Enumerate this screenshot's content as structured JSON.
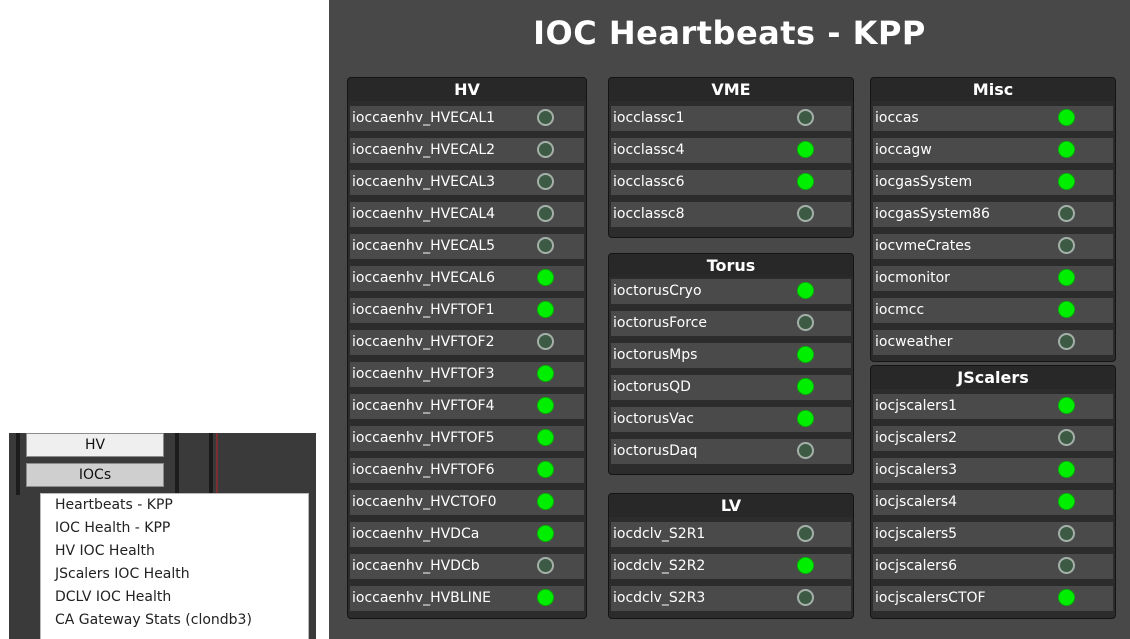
{
  "menu": {
    "hv_button": "HV",
    "iocs_button": "IOCs",
    "items": [
      "Heartbeats - KPP",
      "IOC Health - KPP",
      "HV IOC Health",
      "JScalers IOC Health",
      "DCLV IOC Health",
      "CA Gateway Stats (clondb3)"
    ]
  },
  "title": "IOC Heartbeats - KPP",
  "colors": {
    "led_on": "#00ee00",
    "led_off": "#3d5a44",
    "panel_bg": "#484848"
  },
  "groups": {
    "hv": {
      "title": "HV",
      "rows": [
        {
          "name": "ioccaenhv_HVECAL1",
          "status": "off"
        },
        {
          "name": "ioccaenhv_HVECAL2",
          "status": "off"
        },
        {
          "name": "ioccaenhv_HVECAL3",
          "status": "off"
        },
        {
          "name": "ioccaenhv_HVECAL4",
          "status": "off"
        },
        {
          "name": "ioccaenhv_HVECAL5",
          "status": "off"
        },
        {
          "name": "ioccaenhv_HVECAL6",
          "status": "on"
        },
        {
          "name": "ioccaenhv_HVFTOF1",
          "status": "on"
        },
        {
          "name": "ioccaenhv_HVFTOF2",
          "status": "off"
        },
        {
          "name": "ioccaenhv_HVFTOF3",
          "status": "on"
        },
        {
          "name": "ioccaenhv_HVFTOF4",
          "status": "on"
        },
        {
          "name": "ioccaenhv_HVFTOF5",
          "status": "on"
        },
        {
          "name": "ioccaenhv_HVFTOF6",
          "status": "on"
        },
        {
          "name": "ioccaenhv_HVCTOF0",
          "status": "on"
        },
        {
          "name": "ioccaenhv_HVDCa",
          "status": "on"
        },
        {
          "name": "ioccaenhv_HVDCb",
          "status": "off"
        },
        {
          "name": "ioccaenhv_HVBLINE",
          "status": "on"
        }
      ]
    },
    "vme": {
      "title": "VME",
      "rows": [
        {
          "name": "iocclassc1",
          "status": "off"
        },
        {
          "name": "iocclassc4",
          "status": "on"
        },
        {
          "name": "iocclassc6",
          "status": "on"
        },
        {
          "name": "iocclassc8",
          "status": "off"
        }
      ]
    },
    "torus": {
      "title": "Torus",
      "rows": [
        {
          "name": "ioctorusCryo",
          "status": "on"
        },
        {
          "name": "ioctorusForce",
          "status": "off"
        },
        {
          "name": "ioctorusMps",
          "status": "on"
        },
        {
          "name": "ioctorusQD",
          "status": "on"
        },
        {
          "name": "ioctorusVac",
          "status": "on"
        },
        {
          "name": "ioctorusDaq",
          "status": "off"
        }
      ]
    },
    "lv": {
      "title": "LV",
      "rows": [
        {
          "name": "iocdclv_S2R1",
          "status": "off"
        },
        {
          "name": "iocdclv_S2R2",
          "status": "on"
        },
        {
          "name": "iocdclv_S2R3",
          "status": "off"
        }
      ]
    },
    "misc": {
      "title": "Misc",
      "rows": [
        {
          "name": "ioccas",
          "status": "on"
        },
        {
          "name": "ioccagw",
          "status": "on"
        },
        {
          "name": "iocgasSystem",
          "status": "on"
        },
        {
          "name": "iocgasSystem86",
          "status": "off"
        },
        {
          "name": "iocvmeCrates",
          "status": "off"
        },
        {
          "name": "iocmonitor",
          "status": "on"
        },
        {
          "name": "iocmcc",
          "status": "on"
        },
        {
          "name": "iocweather",
          "status": "off"
        }
      ]
    },
    "jscalers": {
      "title": "JScalers",
      "rows": [
        {
          "name": "iocjscalers1",
          "status": "on"
        },
        {
          "name": "iocjscalers2",
          "status": "off"
        },
        {
          "name": "iocjscalers3",
          "status": "on"
        },
        {
          "name": "iocjscalers4",
          "status": "on"
        },
        {
          "name": "iocjscalers5",
          "status": "off"
        },
        {
          "name": "iocjscalers6",
          "status": "off"
        },
        {
          "name": "iocjscalersCTOF",
          "status": "on"
        }
      ]
    }
  }
}
